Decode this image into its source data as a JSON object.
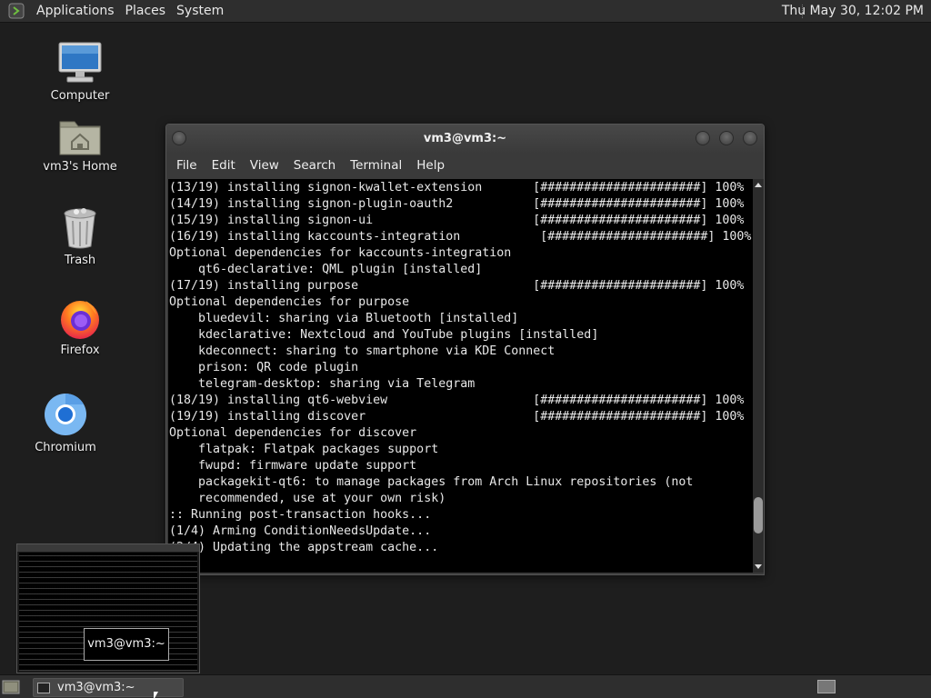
{
  "top_panel": {
    "menus": [
      "Applications",
      "Places",
      "System"
    ],
    "clock": "Thu May 30, 12:02 PM"
  },
  "desktop_icons": {
    "computer": "Computer",
    "home": "vm3's Home",
    "trash": "Trash",
    "firefox": "Firefox",
    "chromium": "Chromium"
  },
  "terminal": {
    "title": "vm3@vm3:~",
    "menus": [
      "File",
      "Edit",
      "View",
      "Search",
      "Terminal",
      "Help"
    ],
    "lines": [
      "(13/19) installing signon-kwallet-extension       [######################] 100%",
      "(14/19) installing signon-plugin-oauth2           [######################] 100%",
      "(15/19) installing signon-ui                      [######################] 100%",
      "(16/19) installing kaccounts-integration           [######################] 100%",
      "Optional dependencies for kaccounts-integration",
      "    qt6-declarative: QML plugin [installed]",
      "(17/19) installing purpose                        [######################] 100%",
      "Optional dependencies for purpose",
      "    bluedevil: sharing via Bluetooth [installed]",
      "    kdeclarative: Nextcloud and YouTube plugins [installed]",
      "    kdeconnect: sharing to smartphone via KDE Connect",
      "    prison: QR code plugin",
      "    telegram-desktop: sharing via Telegram",
      "(18/19) installing qt6-webview                    [######################] 100%",
      "(19/19) installing discover                       [######################] 100%",
      "Optional dependencies for discover",
      "    flatpak: Flatpak packages support",
      "    fwupd: firmware update support",
      "    packagekit-qt6: to manage packages from Arch Linux repositories (not",
      "    recommended, use at your own risk)",
      ":: Running post-transaction hooks...",
      "(1/4) Arming ConditionNeedsUpdate...",
      "(2/4) Updating the appstream cache..."
    ],
    "scroll_position": 0.92
  },
  "thumbnail": {
    "tooltip": "vm3@vm3:~"
  },
  "bottom_panel": {
    "task_label": "vm3@vm3:~"
  }
}
